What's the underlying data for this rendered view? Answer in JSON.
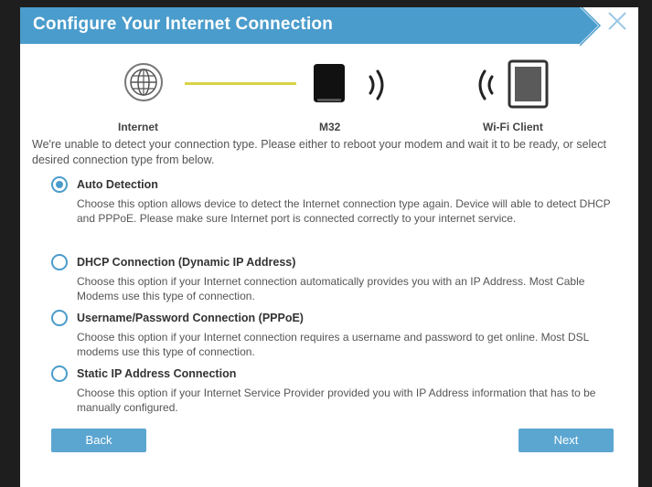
{
  "dialog": {
    "title": "Configure Your Internet Connection"
  },
  "diagram": {
    "internet_label": "Internet",
    "device_label": "M32",
    "client_label": "Wi-Fi Client",
    "connector_color": "#d9d247"
  },
  "intro_text": "We're unable to detect your connection type. Please either to reboot your modem and wait it to be ready, or select desired connection type from below.",
  "options": [
    {
      "title": "Auto Detection",
      "description": "Choose this option allows device to detect the Internet connection type again. Device will able to detect DHCP and PPPoE. Please make sure Internet port is connected correctly to your internet service.",
      "selected": true
    },
    {
      "title": "DHCP Connection (Dynamic IP Address)",
      "description": "Choose this option if your Internet connection automatically provides you with an IP Address. Most Cable Modems use this type of connection.",
      "selected": false
    },
    {
      "title": "Username/Password Connection (PPPoE)",
      "description": "Choose this option if your Internet connection requires a username and password to get online. Most DSL modems use this type of connection.",
      "selected": false
    },
    {
      "title": "Static IP Address Connection",
      "description": "Choose this option if your Internet Service Provider provided you with IP Address information that has to be manually configured.",
      "selected": false
    }
  ],
  "buttons": {
    "back": "Back",
    "next": "Next"
  },
  "colors": {
    "accent": "#4a9ccc",
    "button": "#5ba6d1",
    "frame": "#1e1e1e"
  },
  "icons": [
    "globe-icon",
    "router-icon",
    "wifi-signal-icon",
    "phone-icon",
    "close-icon"
  ]
}
